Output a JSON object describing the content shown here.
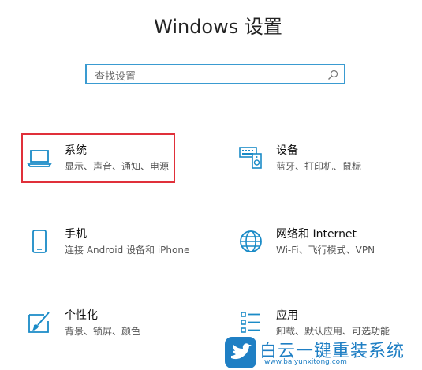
{
  "window": {
    "title": "Windows 设置"
  },
  "search": {
    "placeholder": "查找设置",
    "icon": "search-icon"
  },
  "accent": "#1a8bc7",
  "selected_tile": "system",
  "tiles": [
    {
      "id": "system",
      "icon": "laptop-icon",
      "name": "系统",
      "desc": "显示、声音、通知、电源"
    },
    {
      "id": "devices",
      "icon": "devices-icon",
      "name": "设备",
      "desc": "蓝牙、打印机、鼠标"
    },
    {
      "id": "phone",
      "icon": "phone-icon",
      "name": "手机",
      "desc": "连接 Android 设备和 iPhone"
    },
    {
      "id": "network",
      "icon": "globe-icon",
      "name": "网络和 Internet",
      "desc": "Wi-Fi、飞行模式、VPN"
    },
    {
      "id": "personalization",
      "icon": "paintbrush-icon",
      "name": "个性化",
      "desc": "背景、锁屏、颜色"
    },
    {
      "id": "apps",
      "icon": "apps-list-icon",
      "name": "应用",
      "desc": "卸载、默认应用、可选功能"
    }
  ],
  "watermark": {
    "text": "白云一键重装系统",
    "url": "www.baiyunxitong.com"
  }
}
